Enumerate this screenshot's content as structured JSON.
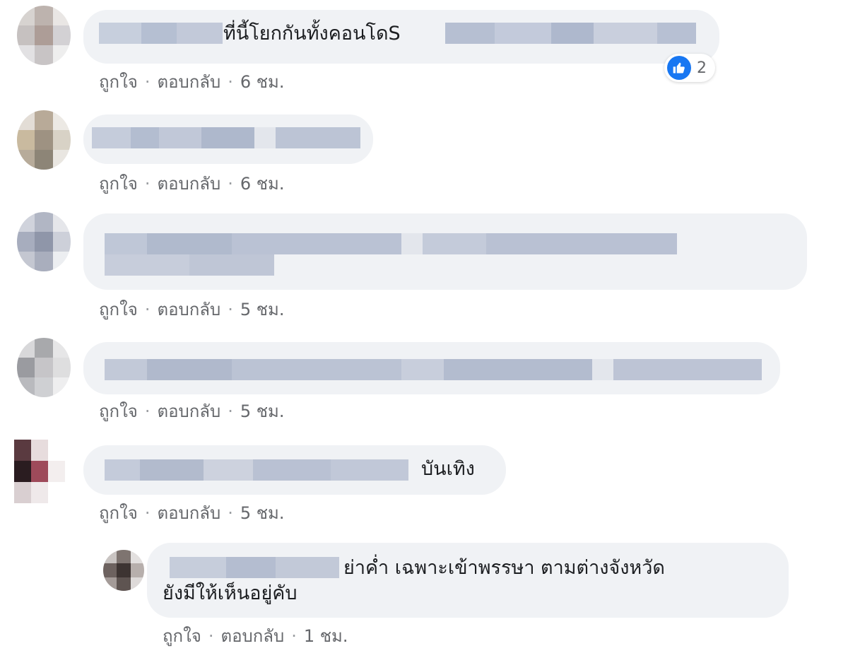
{
  "comments": [
    {
      "text_visible": "ที่นี้โยกกันทั้งคอนโดS",
      "actions": {
        "like": "ถูกใจ",
        "reply": "ตอบกลับ",
        "time": "6 ชม."
      },
      "reaction": {
        "icon": "thumbs-up-icon",
        "count": "2"
      }
    },
    {
      "text_visible": "",
      "actions": {
        "like": "ถูกใจ",
        "reply": "ตอบกลับ",
        "time": "6 ชม."
      }
    },
    {
      "text_visible": "",
      "actions": {
        "like": "ถูกใจ",
        "reply": "ตอบกลับ",
        "time": "5 ชม."
      }
    },
    {
      "text_visible": "",
      "actions": {
        "like": "ถูกใจ",
        "reply": "ตอบกลับ",
        "time": "5 ชม."
      }
    },
    {
      "text_visible": "บันเทิง",
      "actions": {
        "like": "ถูกใจ",
        "reply": "ตอบกลับ",
        "time": "5 ชม."
      }
    }
  ],
  "reply": {
    "line1": "ย่าค่ำ เฉพาะเข้าพรรษา ตามต่างจังหวัด",
    "line2": "ยังมีให้เห็นอยู่คับ",
    "actions": {
      "like": "ถูกใจ",
      "reply": "ตอบกลับ",
      "time": "1 ชม."
    }
  },
  "colors": {
    "bubble": "#f0f2f5",
    "meta_text": "#65676b",
    "like_blue": "#1877f2",
    "blur_block": "#b9c2d4"
  }
}
